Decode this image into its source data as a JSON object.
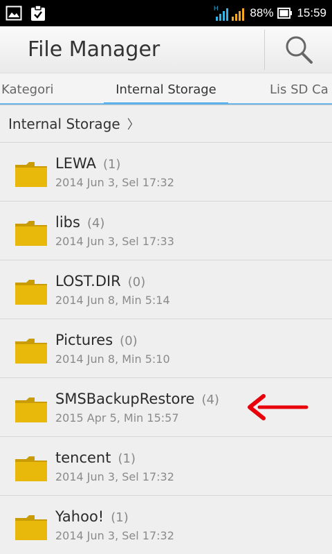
{
  "status_bar": {
    "battery_percent": "88%",
    "time": "15:59",
    "network_type": "H",
    "icons": [
      "gallery-icon",
      "clipboard-check-icon",
      "signal-icon",
      "battery-icon"
    ],
    "colors": {
      "signal_primary": "#33b5e5",
      "signal_secondary": "#f5a623"
    }
  },
  "action_bar": {
    "title": "File Manager",
    "search_icon": "search-icon"
  },
  "tabs": [
    {
      "label": "Kategori",
      "selected": false
    },
    {
      "label": "Internal Storage",
      "selected": true
    },
    {
      "label": "Lis SD Ca",
      "selected": false
    }
  ],
  "breadcrumb": {
    "label": "Internal Storage",
    "chevron": "〉"
  },
  "files": [
    {
      "name": "LEWA",
      "count": "(1)",
      "date": "2014 Jun 3, Sel 17:32"
    },
    {
      "name": "libs",
      "count": "(4)",
      "date": "2014 Jun 3, Sel 17:33"
    },
    {
      "name": "LOST.DIR",
      "count": "(0)",
      "date": "2014 Jun 8, Min 5:14"
    },
    {
      "name": "Pictures",
      "count": "(0)",
      "date": "2014 Jun 8, Min 5:10"
    },
    {
      "name": "SMSBackupRestore",
      "count": "(4)",
      "date": "2015 Apr 5, Min 15:57"
    },
    {
      "name": "tencent",
      "count": "(1)",
      "date": "2014 Jun 3, Sel 17:32"
    },
    {
      "name": "Yahoo!",
      "count": "(1)",
      "date": "2014 Jun 3, Sel 17:32"
    }
  ],
  "colors": {
    "tab_accent": "#2e9be6",
    "folder": "#e8b80a",
    "annotation_arrow": "#e8000b"
  }
}
